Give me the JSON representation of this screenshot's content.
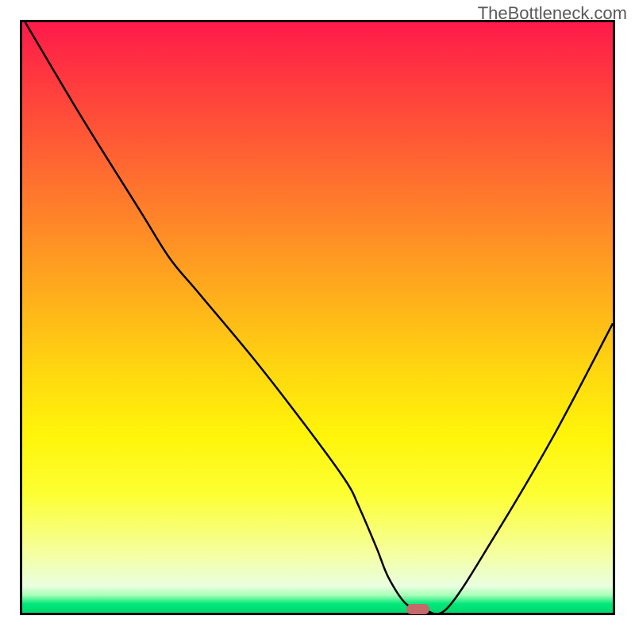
{
  "watermark": "TheBottleneck.com",
  "chart_data": {
    "type": "line",
    "title": "",
    "xlabel": "",
    "ylabel": "",
    "xlim": [
      0,
      100
    ],
    "ylim": [
      0,
      100
    ],
    "x": [
      0.5,
      10,
      20,
      25,
      30,
      40,
      50,
      55,
      57,
      60,
      62,
      65,
      68,
      72,
      80,
      90,
      100
    ],
    "y": [
      100,
      84,
      68,
      60,
      54,
      42,
      29,
      22,
      18,
      11,
      6,
      1.5,
      0.5,
      0.8,
      13,
      30,
      49
    ],
    "marker": {
      "x": 67,
      "y": 0.6,
      "w": 4,
      "h": 1.8
    },
    "background_gradient": {
      "top": "#ff1a4a",
      "mid": "#ffda0f",
      "bottom": "#00d870"
    }
  }
}
